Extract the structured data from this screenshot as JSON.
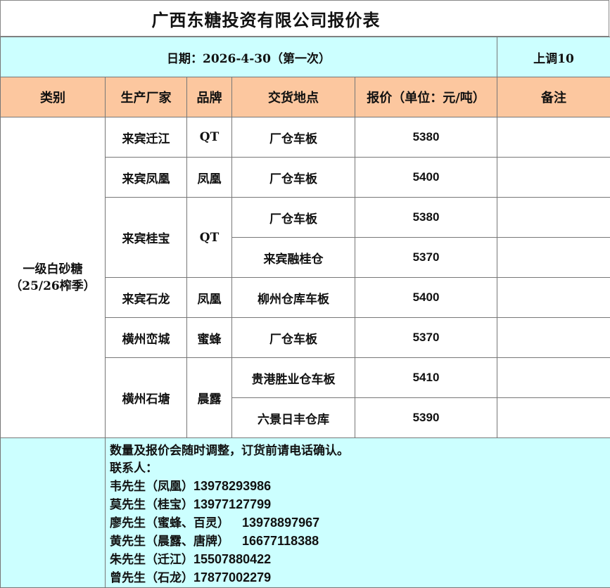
{
  "title": "广西东糖投资有限公司报价表",
  "date_line": "日期：2026-4-30（第一次）",
  "adjustment": "上调10",
  "headers": {
    "category": "类别",
    "manufacturer": "生产厂家",
    "brand": "品牌",
    "delivery": "交货地点",
    "price": "报价（单位：元/吨）",
    "remarks": "备注"
  },
  "category": {
    "line1": "一级白砂糖",
    "line2": "（25/26榨季）"
  },
  "rows": [
    {
      "manufacturer": "来宾迁江",
      "brand": "QT",
      "delivery": "厂仓车板",
      "price": "5380",
      "remark": ""
    },
    {
      "manufacturer": "来宾凤凰",
      "brand": "凤凰",
      "delivery": "厂仓车板",
      "price": "5400",
      "remark": ""
    },
    {
      "manufacturer": "来宾桂宝",
      "brand": "QT",
      "delivery": "厂仓车板",
      "price": "5380",
      "remark": ""
    },
    {
      "manufacturer": "",
      "brand": "",
      "delivery": "来宾融桂仓",
      "price": "5370",
      "remark": ""
    },
    {
      "manufacturer": "来宾石龙",
      "brand": "凤凰",
      "delivery": "柳州仓库车板",
      "price": "5400",
      "remark": ""
    },
    {
      "manufacturer": "横州峦城",
      "brand": "蜜蜂",
      "delivery": "厂仓车板",
      "price": "5370",
      "remark": ""
    },
    {
      "manufacturer": "横州石塘",
      "brand": "晨露",
      "delivery": "贵港胜业仓车板",
      "price": "5410",
      "remark": ""
    },
    {
      "manufacturer": "",
      "brand": "",
      "delivery": "六景日丰仓库",
      "price": "5390",
      "remark": ""
    }
  ],
  "footer": {
    "notice": "数量及报价会随时调整，订货前请电话确认。",
    "contact_label": "联系人：",
    "contacts": [
      {
        "name": "韦先生（凤凰）",
        "phone": "13978293986"
      },
      {
        "name": "莫先生（桂宝）",
        "phone": "13977127799"
      },
      {
        "name": "廖先生（蜜蜂、百灵）",
        "phone": "13978897967"
      },
      {
        "name": "黄先生（晨露、唐牌）",
        "phone": "16677118388"
      },
      {
        "name": "朱先生（迁江）",
        "phone": "15507880422"
      },
      {
        "name": "曾先生（石龙）",
        "phone": "17877002279"
      }
    ]
  },
  "colors": {
    "header_band": "#fcc79f",
    "info_band": "#ccffff",
    "grid_line": "#777777"
  }
}
